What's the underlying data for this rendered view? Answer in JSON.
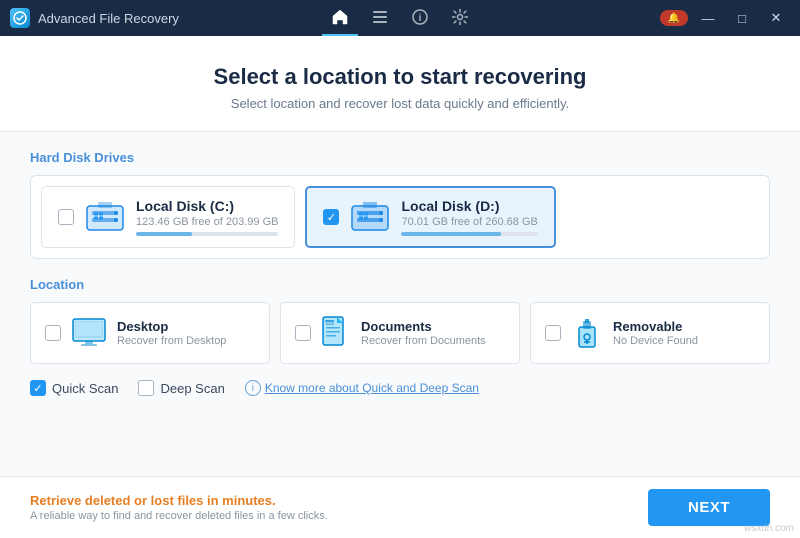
{
  "titlebar": {
    "app_name": "Advanced File Recovery",
    "nav_items": [
      {
        "label": "🏠",
        "id": "home",
        "active": true
      },
      {
        "label": "📋",
        "id": "list",
        "active": false
      },
      {
        "label": "ℹ",
        "id": "info",
        "active": false
      },
      {
        "label": "⚙",
        "id": "settings",
        "active": false
      }
    ],
    "controls": {
      "update": "🔔",
      "minimize": "—",
      "maximize": "□",
      "close": "✕"
    }
  },
  "header": {
    "title": "Select a location to start recovering",
    "subtitle": "Select location and recover lost data quickly and efficiently."
  },
  "hard_disk_drives": {
    "section_label": "Hard Disk Drives",
    "drives": [
      {
        "id": "c",
        "name": "Local Disk (C:)",
        "space": "123.46 GB free of 203.99 GB",
        "used_pct": 39,
        "selected": false
      },
      {
        "id": "d",
        "name": "Local Disk (D:)",
        "space": "70.01 GB free of 260.68 GB",
        "used_pct": 73,
        "selected": true
      }
    ]
  },
  "location": {
    "section_label": "Location",
    "items": [
      {
        "id": "desktop",
        "name": "Desktop",
        "desc": "Recover from Desktop",
        "selected": false
      },
      {
        "id": "documents",
        "name": "Documents",
        "desc": "Recover from Documents",
        "selected": false
      },
      {
        "id": "removable",
        "name": "Removable",
        "desc": "No Device Found",
        "selected": false
      }
    ]
  },
  "scan_options": {
    "quick_scan": {
      "label": "Quick Scan",
      "checked": true
    },
    "deep_scan": {
      "label": "Deep Scan",
      "checked": false
    },
    "info_link": "Know more about Quick and Deep Scan"
  },
  "footer": {
    "promo": "Retrieve deleted or lost files in minutes.",
    "sub": "A reliable way to find and recover deleted files in a few clicks.",
    "next_button": "NEXT"
  },
  "watermark": "wsxdn.com"
}
